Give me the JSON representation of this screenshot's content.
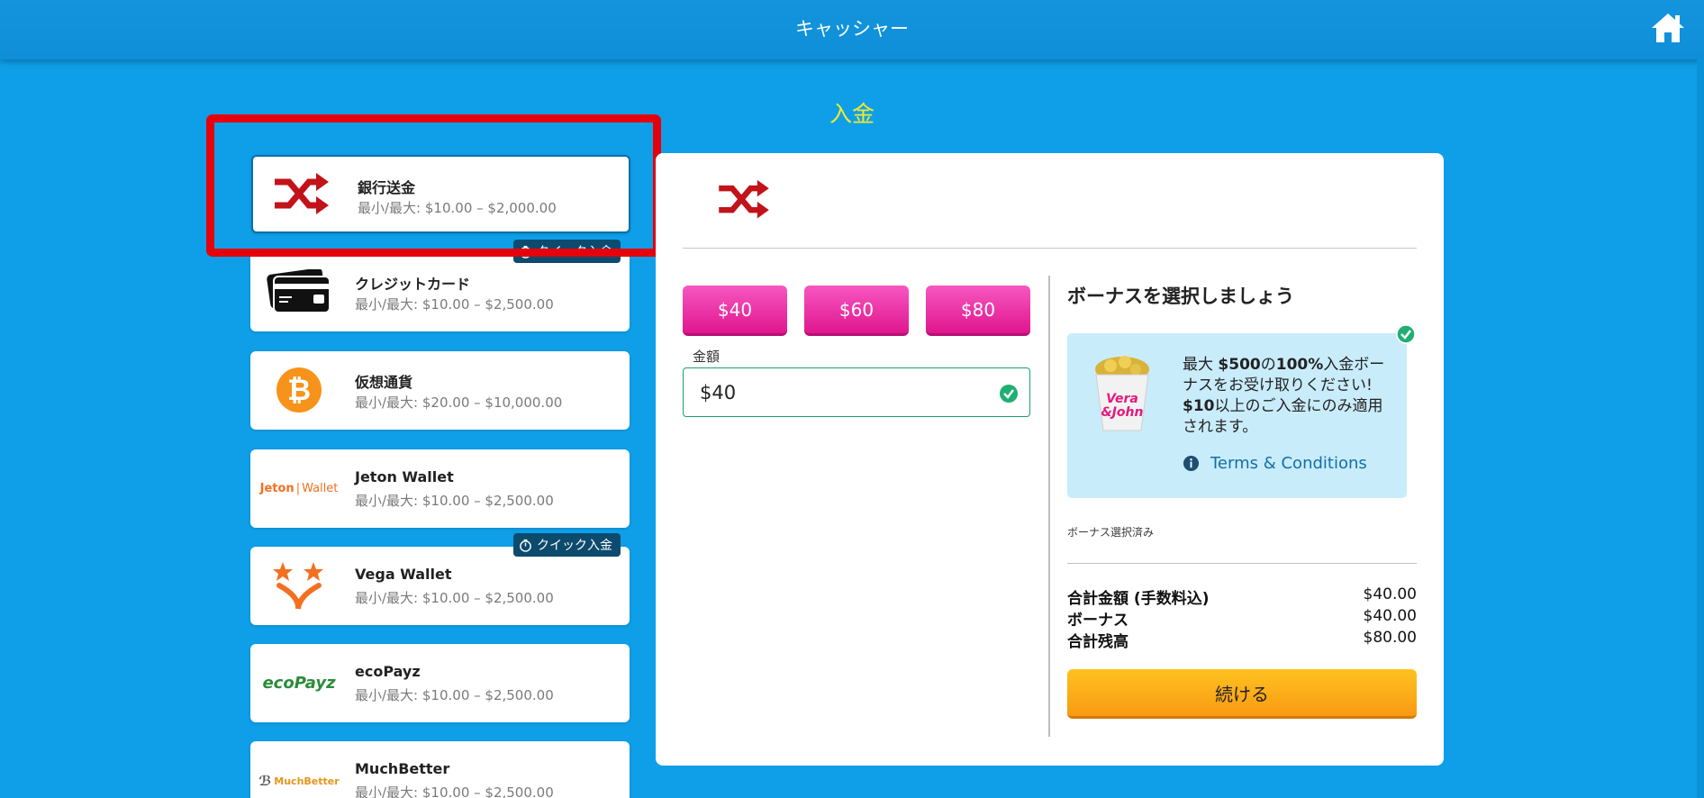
{
  "header": {
    "title": "キャッシャー",
    "home_icon": "home-icon"
  },
  "section_title": "入金",
  "methods": [
    {
      "name": "銀行送金",
      "range": "最小/最大: $10.00 – $2,000.00",
      "icon": "shuffle-arrows-icon",
      "selected": true
    },
    {
      "name": "クレジットカード",
      "range": "最小/最大: $10.00 – $2,500.00",
      "icon": "credit-card-icon",
      "badge": "クイック入金"
    },
    {
      "name": "仮想通貨",
      "range": "最小/最大: $20.00 – $10,000.00",
      "icon": "bitcoin-icon"
    },
    {
      "name": "Jeton Wallet",
      "range": "最小/最大: $10.00 – $2,500.00",
      "icon": "jeton-wallet-logo",
      "logo_text_a": "Jeton",
      "logo_text_b": "Wallet"
    },
    {
      "name": "Vega Wallet",
      "range": "最小/最大: $10.00 – $2,500.00",
      "icon": "vega-wallet-logo",
      "badge": "クイック入金"
    },
    {
      "name": "ecoPayz",
      "range": "最小/最大: $10.00 – $2,500.00",
      "icon": "ecopayz-logo",
      "logo_text": "ecoPayz"
    },
    {
      "name": "MuchBetter",
      "range": "最小/最大: $10.00 – $2,500.00",
      "icon": "muchbetter-logo",
      "logo_text": "MuchBetter"
    }
  ],
  "deposit": {
    "preset_amounts": [
      "$40",
      "$60",
      "$80"
    ],
    "amount_label": "金額",
    "amount_value": "$40"
  },
  "bonus": {
    "heading": "ボーナスを選択しましょう",
    "line1_a": "最大 ",
    "line1_b": "$500",
    "line1_c": "の",
    "line1_d": "100%",
    "line1_e": "入金ボーナスをお受け取りください! ",
    "line2_a": "$10",
    "line2_b": "以上のご入金にのみ適用されます。",
    "terms": "Terms & Conditions",
    "selected_text": "ボーナス選択済み"
  },
  "summary": {
    "rows": [
      {
        "label": "合計金額 (手数料込)",
        "value": "$40.00"
      },
      {
        "label": "ボーナス",
        "value": "$40.00"
      },
      {
        "label": "合計残高",
        "value": "$80.00"
      }
    ],
    "continue_label": "続ける"
  },
  "colors": {
    "background": "#0e9fe8",
    "title_yellow": "#f2e830",
    "pink": "#e0168f",
    "orange": "#f99a14",
    "highlight_red": "#e5000b"
  }
}
